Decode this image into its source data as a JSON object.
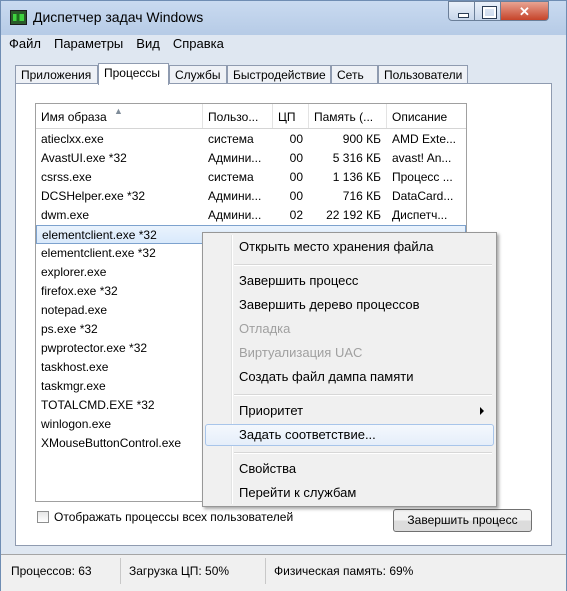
{
  "window": {
    "title": "Диспетчер задач Windows"
  },
  "menu": [
    "Файл",
    "Параметры",
    "Вид",
    "Справка"
  ],
  "tabs": [
    "Приложения",
    "Процессы",
    "Службы",
    "Быстродействие",
    "Сеть",
    "Пользователи"
  ],
  "active_tab": "Процессы",
  "table": {
    "headers": [
      "Имя образа",
      "Пользо...",
      "ЦП",
      "Память (...",
      "Описание"
    ],
    "rows": [
      {
        "name": "atieclxx.exe",
        "user": "система",
        "cpu": "00",
        "mem": "900 КБ",
        "desc": "AMD Exte..."
      },
      {
        "name": "AvastUI.exe *32",
        "user": "Админи...",
        "cpu": "00",
        "mem": "5 316 КБ",
        "desc": "avast! An..."
      },
      {
        "name": "csrss.exe",
        "user": "система",
        "cpu": "00",
        "mem": "1 136 КБ",
        "desc": "Процесс ..."
      },
      {
        "name": "DCSHelper.exe *32",
        "user": "Админи...",
        "cpu": "00",
        "mem": "716 КБ",
        "desc": "DataCard..."
      },
      {
        "name": "dwm.exe",
        "user": "Админи...",
        "cpu": "02",
        "mem": "22 192 КБ",
        "desc": "Диспетч..."
      },
      {
        "name": "elementclient.exe *32",
        "user": "",
        "cpu": "",
        "mem": "",
        "desc": "",
        "selected": true
      },
      {
        "name": "elementclient.exe *32",
        "user": "",
        "cpu": "",
        "mem": "",
        "desc": ""
      },
      {
        "name": "explorer.exe",
        "user": "",
        "cpu": "",
        "mem": "",
        "desc": ""
      },
      {
        "name": "firefox.exe *32",
        "user": "",
        "cpu": "",
        "mem": "",
        "desc": ""
      },
      {
        "name": "notepad.exe",
        "user": "",
        "cpu": "",
        "mem": "",
        "desc": ""
      },
      {
        "name": "ps.exe *32",
        "user": "",
        "cpu": "",
        "mem": "",
        "desc": ""
      },
      {
        "name": "pwprotector.exe *32",
        "user": "",
        "cpu": "",
        "mem": "",
        "desc": ""
      },
      {
        "name": "taskhost.exe",
        "user": "",
        "cpu": "",
        "mem": "",
        "desc": ""
      },
      {
        "name": "taskmgr.exe",
        "user": "",
        "cpu": "",
        "mem": "",
        "desc": ""
      },
      {
        "name": "TOTALCMD.EXE *32",
        "user": "",
        "cpu": "",
        "mem": "",
        "desc": ""
      },
      {
        "name": "winlogon.exe",
        "user": "",
        "cpu": "",
        "mem": "",
        "desc": ""
      },
      {
        "name": "XMouseButtonControl.exe",
        "user": "",
        "cpu": "",
        "mem": "",
        "desc": ""
      }
    ]
  },
  "context_menu": [
    {
      "label": "Открыть место хранения файла"
    },
    {
      "separator": true
    },
    {
      "label": "Завершить процесс"
    },
    {
      "label": "Завершить дерево процессов"
    },
    {
      "label": "Отладка",
      "disabled": true
    },
    {
      "label": "Виртуализация UAC",
      "disabled": true
    },
    {
      "label": "Создать файл дампа памяти"
    },
    {
      "separator": true
    },
    {
      "label": "Приоритет",
      "submenu": true
    },
    {
      "label": "Задать соответствие...",
      "hover": true
    },
    {
      "separator": true
    },
    {
      "label": "Свойства"
    },
    {
      "label": "Перейти к службам"
    }
  ],
  "show_all_users_label": "Отображать процессы всех пользователей",
  "show_all_users_checked": false,
  "end_process_button": "Завершить процесс",
  "status": {
    "processes": "Процессов: 63",
    "cpu": "Загрузка ЦП: 50%",
    "memory": "Физическая память: 69%"
  }
}
